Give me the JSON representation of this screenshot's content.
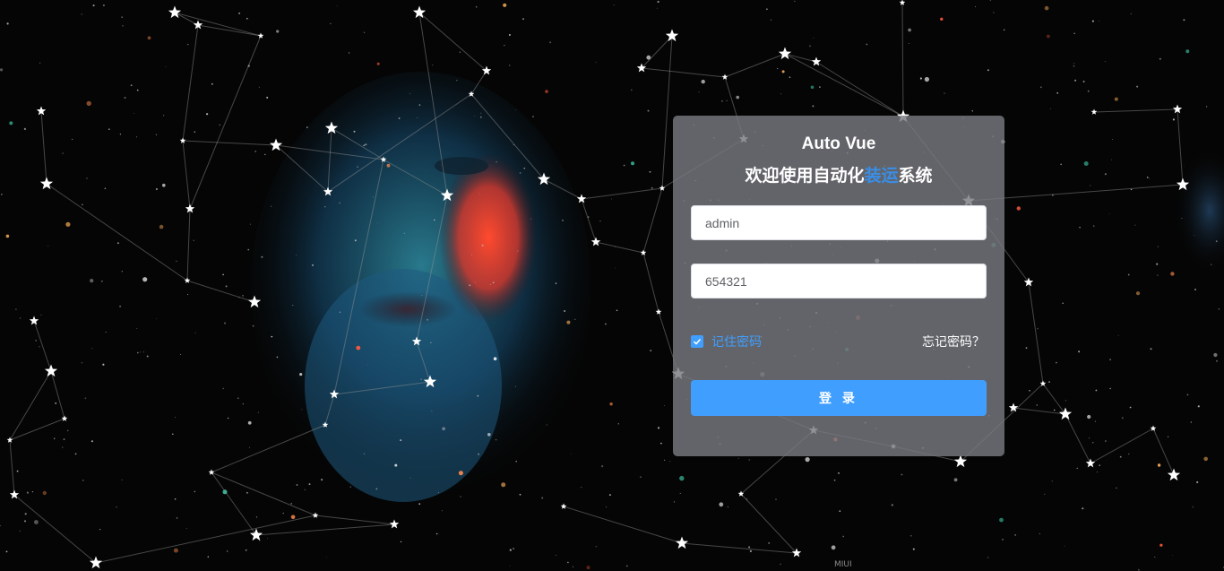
{
  "login": {
    "title": "Auto Vue",
    "subtitle_prefix": "欢迎使用自动化",
    "subtitle_highlight": "装运",
    "subtitle_suffix": "系统",
    "username_value": "admin",
    "password_value": "654321",
    "remember_label": "记住密码",
    "remember_checked": true,
    "forgot_label": "忘记密码？",
    "submit_label": "登 录"
  },
  "watermark": "MIUI",
  "colors": {
    "accent": "#409eff",
    "background": "#050505",
    "card": "#787a80"
  }
}
